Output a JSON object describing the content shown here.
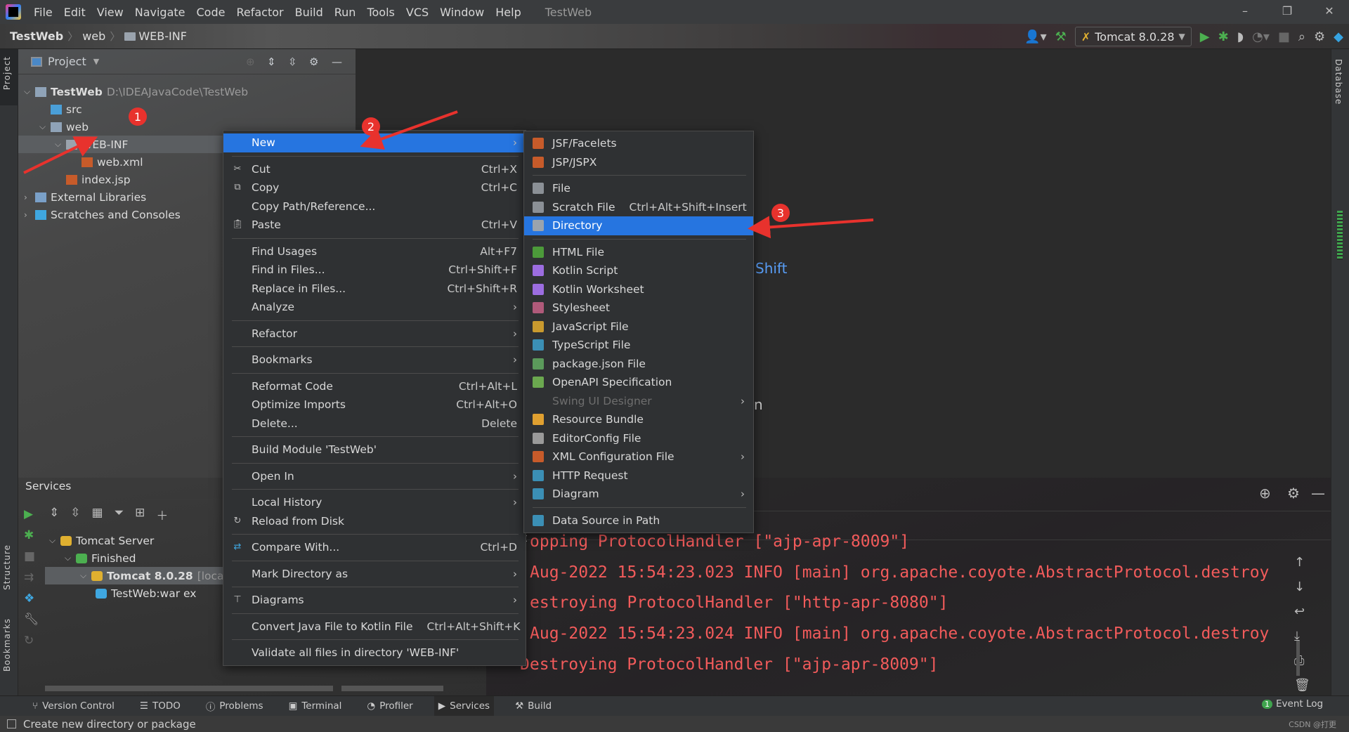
{
  "titlebar": {
    "menus": [
      "File",
      "Edit",
      "View",
      "Navigate",
      "Code",
      "Refactor",
      "Build",
      "Run",
      "Tools",
      "VCS",
      "Window",
      "Help"
    ],
    "title": "TestWeb",
    "minimize": "–",
    "restore": "❐",
    "close": "✕"
  },
  "breadcrumb": [
    "TestWeb",
    "web",
    "WEB-INF"
  ],
  "toolbar": {
    "run_config": "Tomcat 8.0.28"
  },
  "left_stripe": {
    "project": "Project",
    "structure": "Structure",
    "bookmarks": "Bookmarks"
  },
  "right_stripe": {
    "database": "Database"
  },
  "project": {
    "title": "Project",
    "tree": [
      {
        "label": "TestWeb",
        "path": "D:\\IDEAJavaCode\\TestWeb",
        "icon": "module",
        "expanded": true,
        "level": 0,
        "bold": true
      },
      {
        "label": "src",
        "icon": "folder-blue",
        "level": 1
      },
      {
        "label": "web",
        "icon": "folder-web",
        "expanded": true,
        "level": 1
      },
      {
        "label": "WEB-INF",
        "icon": "folder",
        "expanded": true,
        "level": 2,
        "selected": true
      },
      {
        "label": "web.xml",
        "icon": "xml-file",
        "level": 3
      },
      {
        "label": "index.jsp",
        "icon": "jsp-file",
        "level": 2
      },
      {
        "label": "External Libraries",
        "icon": "library",
        "expanded": false,
        "level": 0
      },
      {
        "label": "Scratches and Consoles",
        "icon": "scratch",
        "expanded": false,
        "level": 0
      }
    ]
  },
  "context_menu": [
    {
      "label": "New",
      "submenu": true,
      "highlighted": true
    },
    {
      "separator": true
    },
    {
      "label": "Cut",
      "shortcut": "Ctrl+X",
      "icon": "scissors"
    },
    {
      "label": "Copy",
      "shortcut": "Ctrl+C",
      "icon": "copy"
    },
    {
      "label": "Copy Path/Reference..."
    },
    {
      "label": "Paste",
      "shortcut": "Ctrl+V",
      "icon": "paste"
    },
    {
      "separator": true
    },
    {
      "label": "Find Usages",
      "shortcut": "Alt+F7"
    },
    {
      "label": "Find in Files...",
      "shortcut": "Ctrl+Shift+F"
    },
    {
      "label": "Replace in Files...",
      "shortcut": "Ctrl+Shift+R"
    },
    {
      "label": "Analyze",
      "submenu": true
    },
    {
      "separator": true
    },
    {
      "label": "Refactor",
      "submenu": true
    },
    {
      "separator": true
    },
    {
      "label": "Bookmarks",
      "submenu": true
    },
    {
      "separator": true
    },
    {
      "label": "Reformat Code",
      "shortcut": "Ctrl+Alt+L"
    },
    {
      "label": "Optimize Imports",
      "shortcut": "Ctrl+Alt+O"
    },
    {
      "label": "Delete...",
      "shortcut": "Delete"
    },
    {
      "separator": true
    },
    {
      "label": "Build Module 'TestWeb'"
    },
    {
      "separator": true
    },
    {
      "label": "Open In",
      "submenu": true
    },
    {
      "separator": true
    },
    {
      "label": "Local History",
      "submenu": true
    },
    {
      "label": "Reload from Disk",
      "icon": "reload"
    },
    {
      "separator": true
    },
    {
      "label": "Compare With...",
      "shortcut": "Ctrl+D",
      "icon": "compare"
    },
    {
      "separator": true
    },
    {
      "label": "Mark Directory as",
      "submenu": true
    },
    {
      "separator": true
    },
    {
      "label": "Diagrams",
      "submenu": true,
      "icon": "diagram"
    },
    {
      "separator": true
    },
    {
      "label": "Convert Java File to Kotlin File",
      "shortcut": "Ctrl+Alt+Shift+K"
    },
    {
      "separator": true
    },
    {
      "label": "Validate all files in directory 'WEB-INF'"
    }
  ],
  "new_submenu": [
    {
      "label": "JSF/Facelets",
      "icon": "jsf",
      "color": "#c75b2a"
    },
    {
      "label": "JSP/JSPX",
      "icon": "jsp",
      "color": "#c75b2a"
    },
    {
      "separator": true
    },
    {
      "label": "File",
      "icon": "file",
      "color": "#8b9096"
    },
    {
      "label": "Scratch File",
      "shortcut": "Ctrl+Alt+Shift+Insert",
      "icon": "scratch-file",
      "color": "#8b9096"
    },
    {
      "label": "Directory",
      "icon": "folder",
      "color": "#9aa3ad",
      "highlighted": true
    },
    {
      "separator": true
    },
    {
      "label": "HTML File",
      "icon": "html",
      "color": "#4c9a3a"
    },
    {
      "label": "Kotlin Script",
      "icon": "kotlin",
      "color": "#9c6de0"
    },
    {
      "label": "Kotlin Worksheet",
      "icon": "kotlin",
      "color": "#9c6de0"
    },
    {
      "label": "Stylesheet",
      "icon": "css",
      "color": "#b05a7a"
    },
    {
      "label": "JavaScript File",
      "icon": "js",
      "color": "#c99a2e"
    },
    {
      "label": "TypeScript File",
      "icon": "ts",
      "color": "#3b8fb5"
    },
    {
      "label": "package.json File",
      "icon": "nodejs",
      "color": "#5b9a5b"
    },
    {
      "label": "OpenAPI Specification",
      "icon": "openapi",
      "color": "#6ba84f"
    },
    {
      "label": "Swing UI Designer",
      "submenu": true,
      "disabled": true
    },
    {
      "label": "Resource Bundle",
      "icon": "resource-bundle",
      "color": "#e0a030"
    },
    {
      "label": "EditorConfig File",
      "icon": "gear",
      "color": "#9a9a9a"
    },
    {
      "label": "XML Configuration File",
      "submenu": true,
      "icon": "xml",
      "color": "#c75b2a"
    },
    {
      "label": "HTTP Request",
      "icon": "api",
      "color": "#3b8fb5"
    },
    {
      "label": "Diagram",
      "submenu": true,
      "icon": "diagram",
      "color": "#3b8fb5"
    },
    {
      "separator": true
    },
    {
      "label": "Data Source in Path",
      "icon": "database",
      "color": "#3b8fb5"
    }
  ],
  "editor": {
    "hint_shift": "Shift",
    "hint_n": "n"
  },
  "services": {
    "title": "Services",
    "tree": [
      {
        "label": "Tomcat Server",
        "level": 0,
        "icon": "tomcat"
      },
      {
        "label": "Finished",
        "level": 1,
        "icon": "finished"
      },
      {
        "label": "Tomcat 8.0.28",
        "suffix": "[local]",
        "level": 2,
        "icon": "tomcat",
        "selected": true
      },
      {
        "label": "TestWeb:war ex",
        "level": 3,
        "icon": "artifact"
      }
    ]
  },
  "console": {
    "partial": "t",
    "lines": [
      "opping ProtocolHandler [\"ajp-apr-8009\"]",
      "Aug-2022 15:54:23.023 INFO [main] org.apache.coyote.AbstractProtocol.destroy",
      "estroying ProtocolHandler [\"http-apr-8080\"]",
      "Aug-2022 15:54:23.024 INFO [main] org.apache.coyote.AbstractProtocol.destroy",
      "Destroying ProtocolHandler [\"ajp-apr-8009\"]"
    ],
    "color": "#f25b5b"
  },
  "tool_windows": [
    "Version Control",
    "TODO",
    "Problems",
    "Terminal",
    "Profiler",
    "Services",
    "Build"
  ],
  "active_tool_window": "Services",
  "event_log": {
    "label": "Event Log",
    "count": "1"
  },
  "status": {
    "message": "Create new directory or package",
    "watermark": "CSDN @打更"
  },
  "annotations": [
    "1",
    "2",
    "3"
  ],
  "colors": {
    "accent": "#2675e0",
    "annotation": "#e8322d"
  }
}
